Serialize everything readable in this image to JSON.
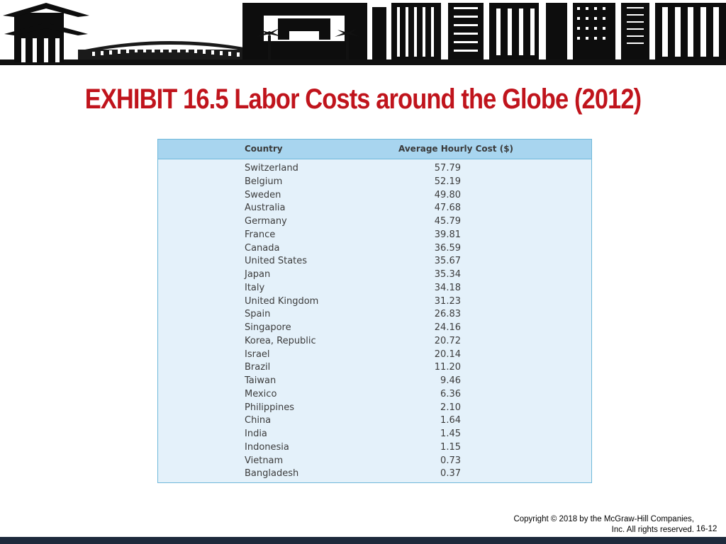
{
  "title": "EXHIBIT 16.5 Labor Costs around the Globe (2012)",
  "table": {
    "headers": [
      "Country",
      "Average Hourly Cost ($)"
    ],
    "rows": [
      {
        "country": "Switzerland",
        "cost": "57.79"
      },
      {
        "country": "Belgium",
        "cost": "52.19"
      },
      {
        "country": "Sweden",
        "cost": "49.80"
      },
      {
        "country": "Australia",
        "cost": "47.68"
      },
      {
        "country": "Germany",
        "cost": "45.79"
      },
      {
        "country": "France",
        "cost": "39.81"
      },
      {
        "country": "Canada",
        "cost": "36.59"
      },
      {
        "country": "United States",
        "cost": "35.67"
      },
      {
        "country": "Japan",
        "cost": "35.34"
      },
      {
        "country": "Italy",
        "cost": "34.18"
      },
      {
        "country": "United Kingdom",
        "cost": "31.23"
      },
      {
        "country": "Spain",
        "cost": "26.83"
      },
      {
        "country": "Singapore",
        "cost": "24.16"
      },
      {
        "country": "Korea, Republic",
        "cost": "20.72"
      },
      {
        "country": "Israel",
        "cost": "20.14"
      },
      {
        "country": "Brazil",
        "cost": "11.20"
      },
      {
        "country": "Taiwan",
        "cost": "9.46"
      },
      {
        "country": "Mexico",
        "cost": "6.36"
      },
      {
        "country": "Philippines",
        "cost": "2.10"
      },
      {
        "country": "China",
        "cost": "1.64"
      },
      {
        "country": "India",
        "cost": "1.45"
      },
      {
        "country": "Indonesia",
        "cost": "1.15"
      },
      {
        "country": "Vietnam",
        "cost": "0.73"
      },
      {
        "country": "Bangladesh",
        "cost": "0.37"
      }
    ]
  },
  "copyright": {
    "line1": "Copyright © 2018 by the McGraw-Hill Companies,",
    "line2": "Inc. All rights reserved."
  },
  "slide_number": "16-12",
  "colors": {
    "title": "#c0141c",
    "table_header_bg": "#a8d5ef",
    "table_body_bg": "#e4f1fa",
    "table_border": "#6fb8da",
    "footer_bar": "#1e2a3c"
  },
  "banner_icon": "city-skyline-silhouette"
}
